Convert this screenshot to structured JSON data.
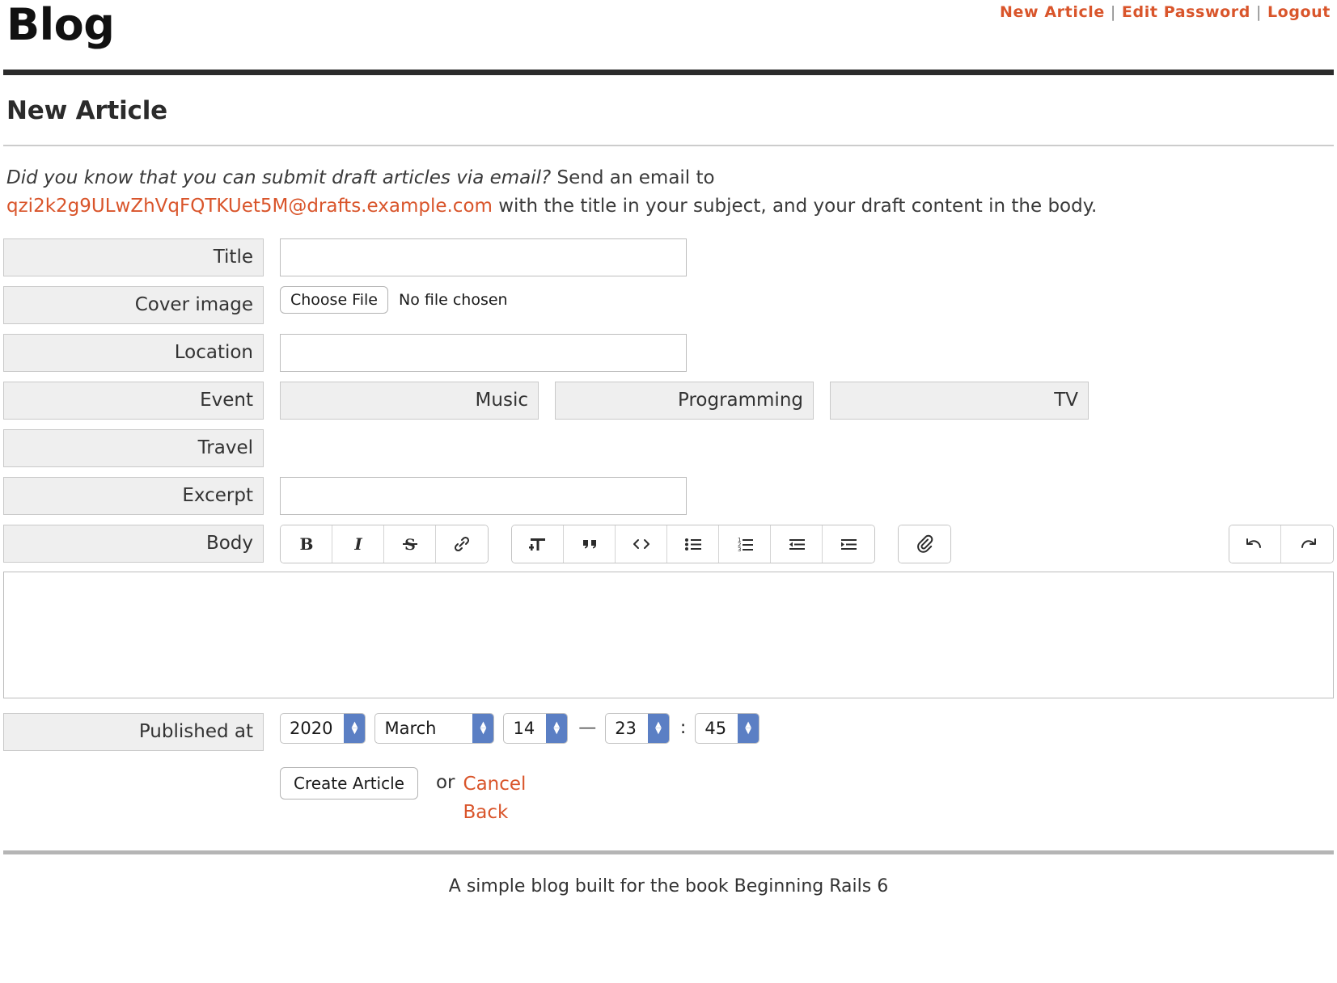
{
  "topnav": {
    "links": [
      {
        "label": "New Article",
        "name": "nav-new-article"
      },
      {
        "label": "Edit Password",
        "name": "nav-edit-password"
      },
      {
        "label": "Logout",
        "name": "nav-logout"
      }
    ],
    "separator": "|"
  },
  "site": {
    "title": "Blog"
  },
  "page": {
    "heading": "New Article"
  },
  "notice": {
    "lead": "Did you know that you can submit draft articles via email?",
    "after_lead": " Send an email to",
    "email": "qzi2k2g9ULwZhVqFQTKUet5M@drafts.example.com",
    "tail": " with the title in your subject, and your draft content in the body."
  },
  "form": {
    "title": {
      "label": "Title",
      "value": "",
      "placeholder": ""
    },
    "cover_image": {
      "label": "Cover image",
      "button_label": "Choose File",
      "status": "No file chosen"
    },
    "location": {
      "label": "Location",
      "value": "",
      "placeholder": ""
    },
    "categories": {
      "row1": [
        {
          "label": "Event",
          "checked": false
        },
        {
          "label": "Music",
          "checked": false
        },
        {
          "label": "Programming",
          "checked": false
        },
        {
          "label": "TV",
          "checked": false
        }
      ],
      "row2": [
        {
          "label": "Travel",
          "checked": false
        }
      ]
    },
    "excerpt": {
      "label": "Excerpt",
      "value": "",
      "placeholder": ""
    },
    "body": {
      "label": "Body",
      "content": "",
      "toolbar": {
        "group1": [
          {
            "icon": "bold-icon",
            "label": "Bold"
          },
          {
            "icon": "italic-icon",
            "label": "Italic"
          },
          {
            "icon": "strikethrough-icon",
            "label": "Strikethrough"
          },
          {
            "icon": "link-icon",
            "label": "Link"
          }
        ],
        "group2": [
          {
            "icon": "heading-icon",
            "label": "Heading"
          },
          {
            "icon": "quote-icon",
            "label": "Quote"
          },
          {
            "icon": "code-icon",
            "label": "Code"
          },
          {
            "icon": "bullet-list-icon",
            "label": "Bullet List"
          },
          {
            "icon": "numbered-list-icon",
            "label": "Numbered List"
          },
          {
            "icon": "decrease-indent-icon",
            "label": "Decrease Level"
          },
          {
            "icon": "increase-indent-icon",
            "label": "Increase Level"
          }
        ],
        "group3": [
          {
            "icon": "attachment-icon",
            "label": "Attach Files"
          }
        ],
        "group4": [
          {
            "icon": "undo-icon",
            "label": "Undo"
          },
          {
            "icon": "redo-icon",
            "label": "Redo"
          }
        ]
      }
    },
    "published_at": {
      "label": "Published at",
      "year": "2020",
      "month": "March",
      "day": "14",
      "hour": "23",
      "minute": "45",
      "date_time_separator": "—",
      "time_separator": ":"
    }
  },
  "actions": {
    "submit_label": "Create Article",
    "or_text": "or",
    "cancel_label": "Cancel",
    "back_label": "Back"
  },
  "footer": {
    "text": "A simple blog built for the book Beginning Rails 6"
  },
  "colors": {
    "accent": "#d9552b",
    "label_bg": "#efefef",
    "stepper_blue": "#5b7fc4",
    "rule_dark": "#2b2b2b"
  }
}
